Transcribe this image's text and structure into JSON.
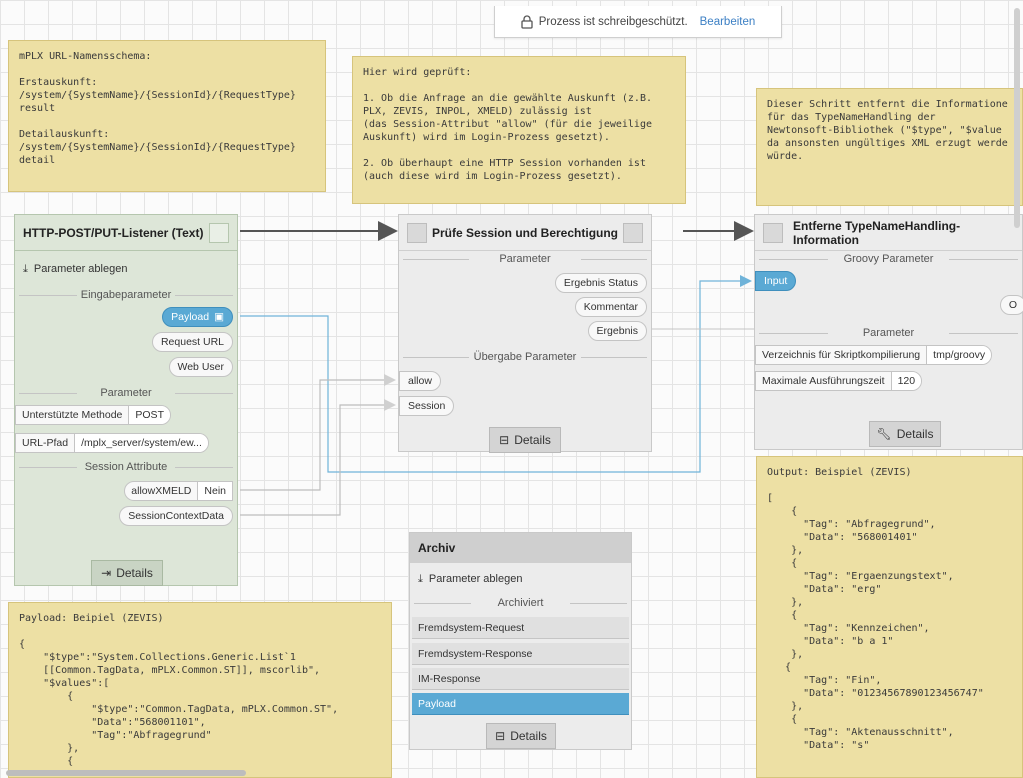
{
  "banner": {
    "text": "Prozess ist schreibgeschützt.",
    "edit_label": "Bearbeiten"
  },
  "notes": {
    "url_schema": "mPLX URL-Namensschema:\n\nErstauskunft:\n/system/{SystemName}/{SessionId}/{RequestType}\nresult\n\nDetailauskunft:\n/system/{SystemName}/{SessionId}/{RequestType}\ndetail",
    "check_info": "Hier wird geprüft:\n\n1. Ob die Anfrage an die gewählte Auskunft (z.B.\nPLX, ZEVIS, INPOL, XMELD) zulässig ist\n(das Session-Attribut \"allow\" (für die jeweilige\nAuskunft) wird im Login-Prozess gesetzt).\n\n2. Ob überhaupt eine HTTP Session vorhanden ist\n(auch diese wird im Login-Prozess gesetzt).",
    "typename_info": "Dieser Schritt entfernt die Informatione\nfür das TypeNameHandling der\nNewtonsoft-Bibliothek (\"$type\", \"$value\nda ansonsten ungültiges XML erzugt werde\nwürde.",
    "payload_example": "Payload: Beipiel (ZEVIS)\n\n{\n    \"$type\":\"System.Collections.Generic.List`1\n    [[Common.TagData, mPLX.Common.ST]], mscorlib\",\n    \"$values\":[\n        {\n            \"$type\":\"Common.TagData, mPLX.Common.ST\",\n            \"Data\":\"568001101\",\n            \"Tag\":\"Abfragegrund\"\n        },\n        {",
    "output_example": "Output: Beispiel (ZEVIS)\n\n[\n    {\n      \"Tag\": \"Abfragegrund\",\n      \"Data\": \"568001401\"\n    },\n    {\n      \"Tag\": \"Ergaenzungstext\",\n      \"Data\": \"erg\"\n    },\n    {\n      \"Tag\": \"Kennzeichen\",\n      \"Data\": \"b a 1\"\n    },\n   {\n      \"Tag\": \"Fin\",\n      \"Data\": \"01234567890123456747\"\n    },\n    {\n      \"Tag\": \"Aktenausschnitt\",\n      \"Data\": \"s\""
  },
  "listener": {
    "title": "HTTP-POST/PUT-Listener (Text)",
    "action_label": "Parameter ablegen",
    "section_input": "Eingabeparameter",
    "input_params": [
      "Payload",
      "Request URL",
      "Web User"
    ],
    "section_params": "Parameter",
    "method_key": "Unterstützte Methode",
    "method_val": "POST",
    "path_key": "URL-Pfad",
    "path_val": "/mplx_server/system/ew...",
    "section_session": "Session Attribute",
    "xmeld_key": "allowXMELD",
    "xmeld_val": "Nein",
    "session_context": "SessionContextData",
    "details_label": "Details"
  },
  "check": {
    "title": "Prüfe Session und Berechtigung",
    "section_params": "Parameter",
    "outputs": [
      "Ergebnis Status",
      "Kommentar",
      "Ergebnis"
    ],
    "section_transfer": "Übergabe Parameter",
    "transfer": [
      "allow",
      "Session"
    ],
    "details_label": "Details"
  },
  "remove": {
    "title": "Entferne TypeNameHandling-Information",
    "section_groovy": "Groovy Parameter",
    "input_label": "Input",
    "output_label": "O",
    "section_params": "Parameter",
    "dir_key": "Verzeichnis für Skriptkompilierung",
    "dir_val": "tmp/groovy",
    "time_key": "Maximale Ausführungszeit",
    "time_val": "120",
    "details_label": "Details"
  },
  "archiv": {
    "title": "Archiv",
    "action_label": "Parameter ablegen",
    "section": "Archiviert",
    "rows": [
      "Fremdsystem-Request",
      "Fremdsystem-Response",
      "IM-Response",
      "Payload"
    ],
    "details_label": "Details"
  },
  "colors": {
    "accent": "#5aa9d4",
    "note": "#ede0a4",
    "green_node": "#dde6d8",
    "link": "#3b7fc4"
  }
}
